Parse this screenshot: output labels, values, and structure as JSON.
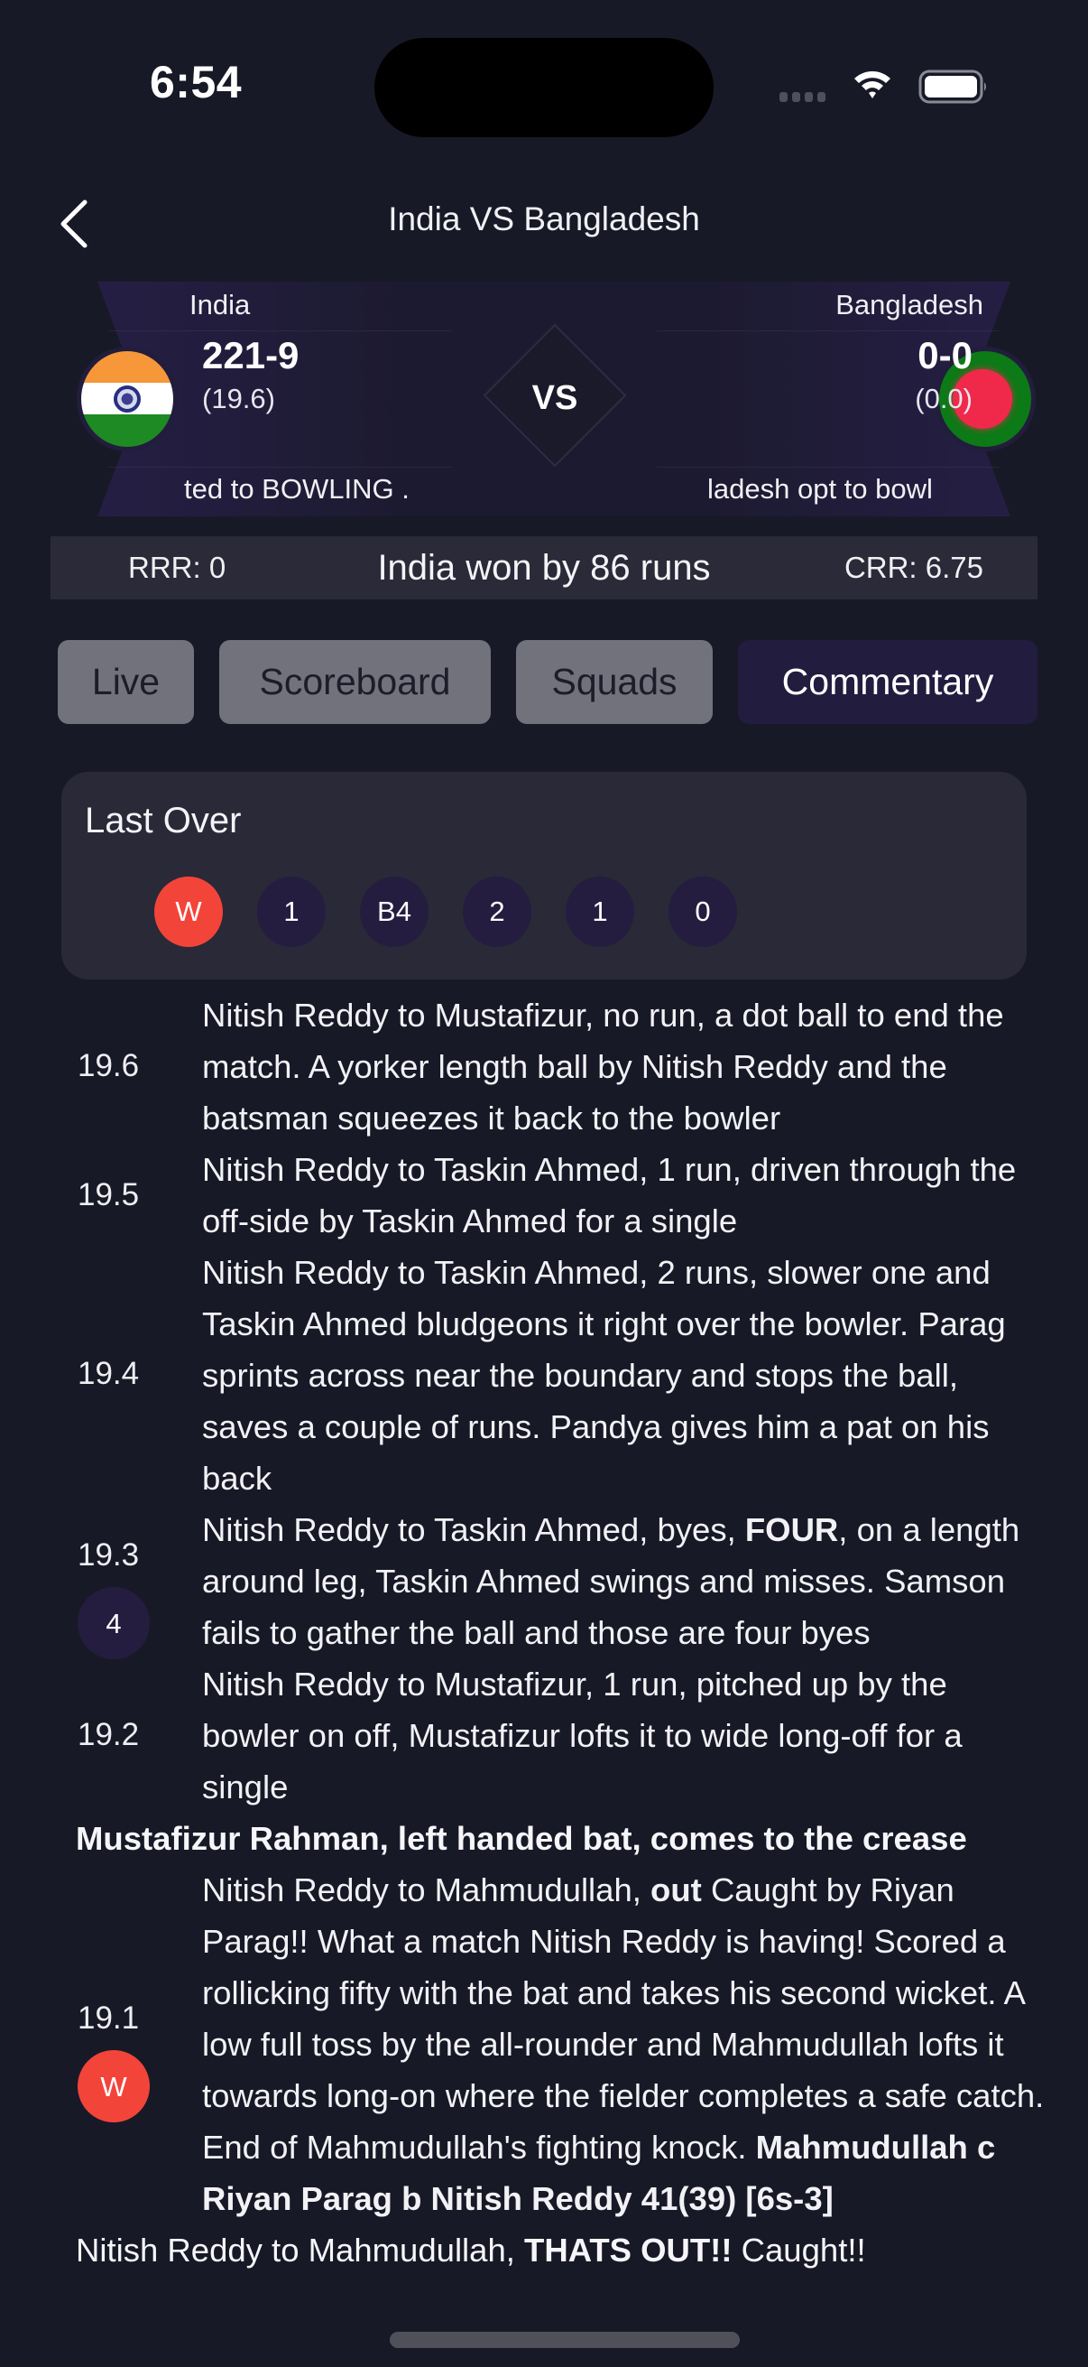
{
  "status_bar": {
    "time": "6:54"
  },
  "nav": {
    "title": "India VS Bangladesh",
    "back_icon": "chevron-left-icon"
  },
  "match": {
    "team1": {
      "name": "India",
      "score": "221-9",
      "overs": "(19.6)",
      "toss_text": "ted to BOWLING   .",
      "flag": "india-flag",
      "flag_colors": [
        "#f6973a",
        "#ffffff",
        "#1e8a23"
      ]
    },
    "team2": {
      "name": "Bangladesh",
      "score": "0-0",
      "overs": "(0.0)",
      "toss_text": "ladesh opt to bowl",
      "flag": "bangladesh-flag",
      "flag_colors": [
        "#0c7a17",
        "#f0294a"
      ]
    },
    "vs_label": "VS",
    "rrr": "RRR: 0",
    "result": "India won by 86 runs",
    "crr": "CRR: 6.75"
  },
  "tabs": [
    {
      "label": "Live",
      "active": false
    },
    {
      "label": "Scoreboard",
      "active": false
    },
    {
      "label": "Squads",
      "active": false
    },
    {
      "label": "Commentary",
      "active": true
    }
  ],
  "last_over": {
    "title": "Last Over",
    "balls": [
      "W",
      "1",
      "B4",
      "2",
      "1",
      "0"
    ]
  },
  "commentary": [
    {
      "over": "19.6",
      "badge": null,
      "segments": [
        {
          "text": "Nitish Reddy to Mustafizur, no run, a dot ball to end the match. A yorker length ball by Nitish Reddy and the batsman squeezes it back to the bowler",
          "bold": false
        }
      ]
    },
    {
      "over": "19.5",
      "badge": null,
      "segments": [
        {
          "text": "Nitish Reddy to Taskin Ahmed, 1 run, driven through the off-side by Taskin Ahmed for a single",
          "bold": false
        }
      ]
    },
    {
      "over": "19.4",
      "badge": null,
      "segments": [
        {
          "text": "Nitish Reddy to Taskin Ahmed, 2 runs, slower one and Taskin Ahmed bludgeons it right over the bowler. Parag sprints across near the boundary and stops the ball, saves a couple of runs. Pandya gives him a pat on his back",
          "bold": false
        }
      ]
    },
    {
      "over": "19.3",
      "badge": "4",
      "segments": [
        {
          "text": "Nitish Reddy to Taskin Ahmed, byes, ",
          "bold": false
        },
        {
          "text": "FOUR",
          "bold": true
        },
        {
          "text": ", on a length around leg, Taskin Ahmed swings and misses. Samson fails to gather the ball and those are four byes",
          "bold": false
        }
      ]
    },
    {
      "over": "19.2",
      "badge": null,
      "segments": [
        {
          "text": "Nitish Reddy to Mustafizur, 1 run, pitched up by the bowler on off, Mustafizur lofts it to wide long-off for a single",
          "bold": false
        }
      ]
    },
    {
      "note": "Mustafizur Rahman, left handed bat, comes to the crease"
    },
    {
      "over": "19.1",
      "badge": "W",
      "segments": [
        {
          "text": "Nitish Reddy to Mahmudullah, ",
          "bold": false
        },
        {
          "text": "out",
          "bold": true
        },
        {
          "text": " Caught by Riyan Parag!! What a match Nitish Reddy is having! Scored a rollicking fifty with the bat and takes his second wicket. A low full toss by the all-rounder and Mahmudullah lofts it towards long-on where the fielder completes a safe catch. End of Mahmudullah's fighting knock. ",
          "bold": false
        },
        {
          "text": "Mahmudullah c Riyan Parag b Nitish Reddy 41(39) [6s-3]",
          "bold": true
        }
      ]
    },
    {
      "note_segments": [
        {
          "text": "Nitish Reddy to Mahmudullah, ",
          "bold": false
        },
        {
          "text": "THATS OUT!!",
          "bold": true
        },
        {
          "text": " Caught!!",
          "bold": false
        }
      ]
    }
  ],
  "colors": {
    "background": "#181926",
    "banner": "#221c3e",
    "wicket": "#f3443a",
    "ball": "#241d3f",
    "tab_inactive": "#72727c",
    "tab_active": "#221c3e"
  }
}
